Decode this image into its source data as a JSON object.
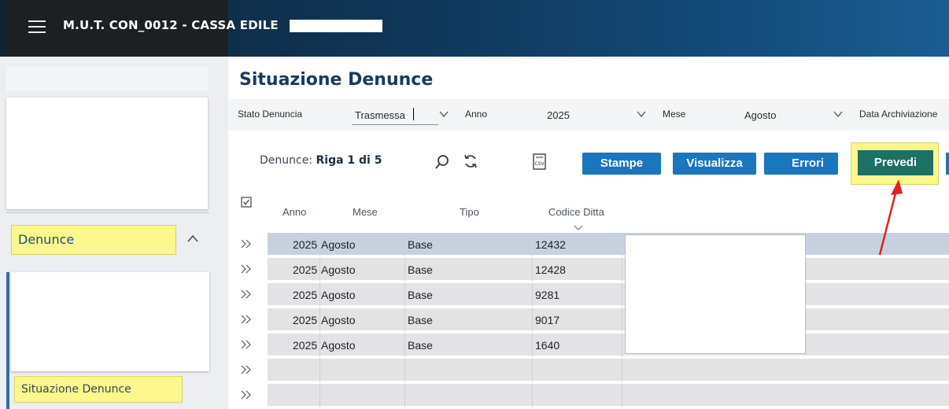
{
  "header": {
    "title": "M.U.T. CON_0012 - CASSA EDILE"
  },
  "sidebar": {
    "section_label": "Denunce",
    "item_label": "Situazione Denunce"
  },
  "page": {
    "title": "Situazione Denunce"
  },
  "filters": {
    "stato_label": "Stato Denuncia",
    "stato_value": "Trasmessa",
    "anno_label": "Anno",
    "anno_value": "2025",
    "mese_label": "Mese",
    "mese_value": "Agosto",
    "data_label": "Data Archiviazione"
  },
  "toolbar": {
    "records_prefix": "Denunce: ",
    "records_value": "Riga 1 di 5",
    "csv_icon_text": "CSV",
    "stampe_label": "Stampe",
    "visualizza_label": "Visualizza",
    "errori_label": "Errori",
    "prevedi_label": "Prevedi"
  },
  "table": {
    "columns": [
      "Anno",
      "Mese",
      "Tipo",
      "Codice Ditta"
    ],
    "rows": [
      {
        "anno": "2025",
        "mese": "Agosto",
        "tipo": "Base",
        "codice": "12432"
      },
      {
        "anno": "2025",
        "mese": "Agosto",
        "tipo": "Base",
        "codice": "12428"
      },
      {
        "anno": "2025",
        "mese": "Agosto",
        "tipo": "Base",
        "codice": "9281"
      },
      {
        "anno": "2025",
        "mese": "Agosto",
        "tipo": "Base",
        "codice": "9017"
      },
      {
        "anno": "2025",
        "mese": "Agosto",
        "tipo": "Base",
        "codice": "1640"
      }
    ]
  },
  "colors": {
    "accent_blue": "#1a76bd",
    "prevedi_green": "#1d7066",
    "highlight_yellow": "#fbf78c",
    "annotation_red": "#e02020"
  }
}
